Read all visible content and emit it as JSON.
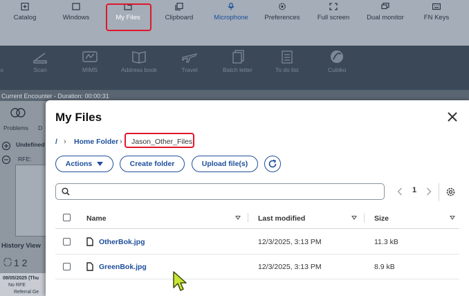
{
  "topbar": {
    "items": [
      {
        "label": "Catalog",
        "icon": "catalog-icon"
      },
      {
        "label": "Windows",
        "icon": "windows-icon"
      },
      {
        "label": "My Files",
        "icon": "folder-icon"
      },
      {
        "label": "Clipboard",
        "icon": "clipboard-icon"
      },
      {
        "label": "Microphone",
        "icon": "microphone-icon"
      },
      {
        "label": "Preferences",
        "icon": "gear-icon"
      },
      {
        "label": "Full screen",
        "icon": "fullscreen-icon"
      },
      {
        "label": "Dual monitor",
        "icon": "dual-monitor-icon"
      },
      {
        "label": "FN Keys",
        "icon": "keyboard-icon"
      }
    ]
  },
  "toolbar2": {
    "items": [
      {
        "label": "ox"
      },
      {
        "label": "Scan"
      },
      {
        "label": "MIMS"
      },
      {
        "label": "Address book"
      },
      {
        "label": "Travel"
      },
      {
        "label": "Batch letter"
      },
      {
        "label": "To do list"
      },
      {
        "label": "Cubiko"
      }
    ]
  },
  "background": {
    "encounter": "Current Encounter - Duration: 00:00:31",
    "problems": "Problems",
    "undefined": "Undefined",
    "rfe": "RFE:",
    "history_view": "History View",
    "pages": "1 2",
    "hist_date": "08/05/2025 (Thu",
    "no_rfe": "No RFE",
    "referral": "Referral Ge"
  },
  "modal": {
    "title": "My Files",
    "breadcrumb": {
      "root": "/",
      "home": "Home Folder",
      "current": "Jason_Other_Files"
    },
    "buttons": {
      "actions": "Actions",
      "create_folder": "Create folder",
      "upload": "Upload file(s)"
    },
    "search": {
      "placeholder": "",
      "value": ""
    },
    "pager": {
      "page": "1"
    },
    "table": {
      "headers": {
        "name": "Name",
        "modified": "Last modified",
        "size": "Size"
      },
      "rows": [
        {
          "name": "OtherBok.jpg",
          "modified": "12/3/2025, 3:13 PM",
          "size": "11.3 kB"
        },
        {
          "name": "GreenBok.jpg",
          "modified": "12/3/2025, 3:13 PM",
          "size": "8.9 kB"
        }
      ]
    }
  },
  "colors": {
    "accent": "#1d4e9a",
    "highlight": "#e0162b",
    "cursor": "#c8e632"
  }
}
